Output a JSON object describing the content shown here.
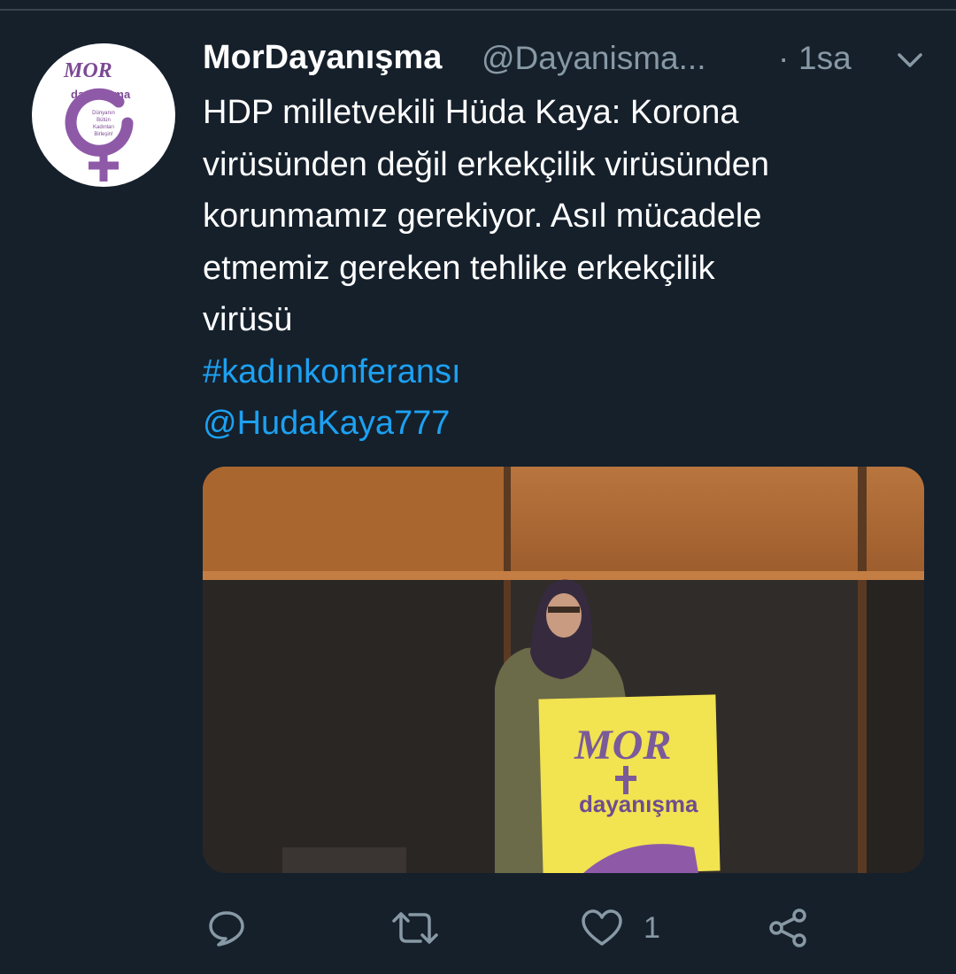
{
  "tweet": {
    "display_name": "MorDayanışma",
    "handle": "@Dayanisma...",
    "separator": "·",
    "time": "1sa",
    "text_lines": [
      "HDP milletvekili Hüda Kaya: Korona",
      "virüsünden değil erkekçilik virüsünden",
      "korunmamız gerekiyor. Asıl mücadele",
      "etmemiz gereken tehlike erkekçilik",
      "virüsü"
    ],
    "hashtag": "#kadınkonferansı",
    "mention": "@HudaKaya777",
    "avatar_logo": {
      "top": "MOR",
      "middle": "dayanışma",
      "motto_lines": [
        "Dünyanın",
        "Bütün",
        "Kadınları",
        "Birleşin!"
      ]
    },
    "media_banner_text": {
      "top": "MOR",
      "bottom": "dayanışma"
    }
  },
  "actions": {
    "like_count": "1",
    "icons": [
      "reply-icon",
      "retweet-icon",
      "like-icon",
      "share-icon"
    ]
  },
  "colors": {
    "background": "#15202b",
    "text": "#ffffff",
    "secondary": "#8899a6",
    "link": "#1da1f2",
    "brand_purple": "#7b4a93"
  }
}
